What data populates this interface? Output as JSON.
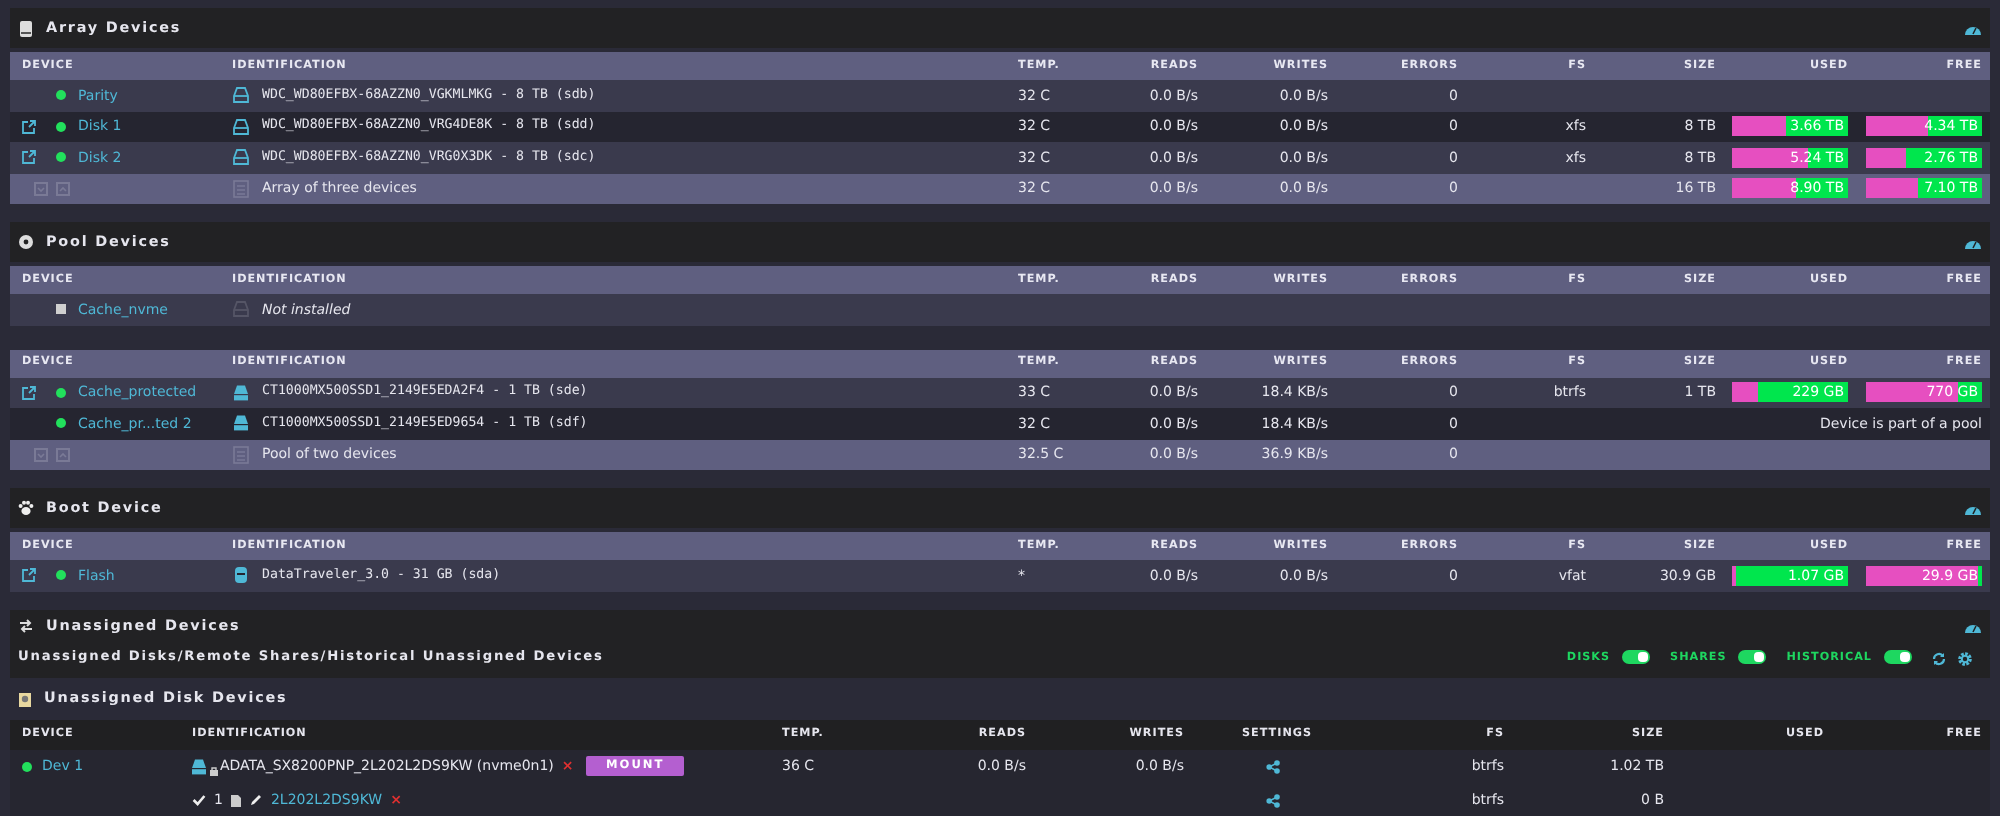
{
  "sections": [
    {
      "title": "Array Devices",
      "tables": [
        {
          "columns": [
            "DEVICE",
            "IDENTIFICATION",
            "TEMP.",
            "READS",
            "WRITES",
            "ERRORS",
            "FS",
            "SIZE",
            "USED",
            "FREE"
          ],
          "rows": [
            {
              "kind": "hdd",
              "link": false,
              "color": "#22e05c",
              "device": "Parity",
              "identification": "WDC_WD80EFBX-68AZZN0_VGKMLMKG - 8 TB (sdb)",
              "temp": "32 C",
              "reads": "0.0 B/s",
              "writes": "0.0 B/s",
              "errors": "0"
            },
            {
              "kind": "hdd",
              "link": true,
              "color": "#22e05c",
              "device": "Disk 1",
              "identification": "WDC_WD80EFBX-68AZZN0_VRG4DE8K - 8 TB (sdd)",
              "temp": "32 C",
              "reads": "0.0 B/s",
              "writes": "0.0 B/s",
              "errors": "0",
              "fs": "xfs",
              "size": "8 TB",
              "used": {
                "text": "3.66 TB",
                "level": 0.46
              },
              "free": {
                "text": "4.34 TB",
                "level": 0.54
              }
            },
            {
              "kind": "hdd",
              "link": true,
              "color": "#22e05c",
              "device": "Disk 2",
              "identification": "WDC_WD80EFBX-68AZZN0_VRG0X3DK - 8 TB (sdc)",
              "temp": "32 C",
              "reads": "0.0 B/s",
              "writes": "0.0 B/s",
              "errors": "0",
              "fs": "xfs",
              "size": "8 TB",
              "used": {
                "text": "5.24 TB",
                "level": 0.65
              },
              "free": {
                "text": "2.76 TB",
                "level": 0.35
              }
            },
            {
              "kind": "summary",
              "identification": "Array of three devices",
              "temp": "32 C",
              "reads": "0.0 B/s",
              "writes": "0.0 B/s",
              "errors": "0",
              "size": "16 TB",
              "used": {
                "text": "8.90 TB",
                "level": 0.56
              },
              "free": {
                "text": "7.10 TB",
                "level": 0.44
              }
            }
          ]
        }
      ]
    },
    {
      "title": "Pool Devices",
      "tables": [
        {
          "columns": [
            "DEVICE",
            "IDENTIFICATION",
            "TEMP.",
            "READS",
            "WRITES",
            "ERRORS",
            "FS",
            "SIZE",
            "USED",
            "FREE"
          ],
          "rows": [
            {
              "kind": "missing",
              "link": false,
              "color": "#cfcfcf",
              "device": "Cache_nvme",
              "identification": "Not installed"
            }
          ]
        },
        {
          "columns": [
            "DEVICE",
            "IDENTIFICATION",
            "TEMP.",
            "READS",
            "WRITES",
            "ERRORS",
            "FS",
            "SIZE",
            "USED",
            "FREE"
          ],
          "rows": [
            {
              "kind": "ssd",
              "link": true,
              "color": "#22e05c",
              "device": "Cache_protected",
              "identification": "CT1000MX500SSD1_2149E5EDA2F4 - 1 TB (sde)",
              "temp": "33 C",
              "reads": "0.0 B/s",
              "writes": "18.4 KB/s",
              "errors": "0",
              "fs": "btrfs",
              "size": "1 TB",
              "used": {
                "text": "229 GB",
                "level": 0.23
              },
              "free": {
                "text": "770 GB",
                "level": 0.79
              }
            },
            {
              "kind": "ssd",
              "link": false,
              "color": "#22e05c",
              "device": "Cache_pr...ted 2",
              "identification": "CT1000MX500SSD1_2149E5ED9654 - 1 TB (sdf)",
              "temp": "32 C",
              "reads": "0.0 B/s",
              "writes": "18.4 KB/s",
              "errors": "0",
              "note": "Device is part of a pool"
            },
            {
              "kind": "summary",
              "identification": "Pool of two devices",
              "temp": "32.5 C",
              "reads": "0.0 B/s",
              "writes": "36.9 KB/s",
              "errors": "0"
            }
          ]
        }
      ]
    },
    {
      "title": "Boot Device",
      "tables": [
        {
          "columns": [
            "DEVICE",
            "IDENTIFICATION",
            "TEMP.",
            "READS",
            "WRITES",
            "ERRORS",
            "FS",
            "SIZE",
            "USED",
            "FREE"
          ],
          "rows": [
            {
              "kind": "usb",
              "link": true,
              "color": "#22e05c",
              "device": "Flash",
              "identification": "DataTraveler_3.0 - 31 GB (sda)",
              "temp": "*",
              "reads": "0.0 B/s",
              "writes": "0.0 B/s",
              "errors": "0",
              "fs": "vfat",
              "size": "30.9 GB",
              "used": {
                "text": "1.07 GB",
                "level": 0.035
              },
              "free": {
                "text": "29.9 GB",
                "level": 0.97
              }
            }
          ]
        }
      ]
    }
  ],
  "unassigned": {
    "title": "Unassigned Devices",
    "subtitle": "Unassigned Disks/Remote Shares/Historical Unassigned Devices",
    "toggles": [
      {
        "label": "DISKS",
        "on": true
      },
      {
        "label": "SHARES",
        "on": true
      },
      {
        "label": "HISTORICAL",
        "on": true
      }
    ],
    "disks": {
      "title": "Unassigned Disk Devices",
      "columns": [
        "DEVICE",
        "IDENTIFICATION",
        "TEMP.",
        "READS",
        "WRITES",
        "SETTINGS",
        "FS",
        "SIZE",
        "USED",
        "FREE"
      ],
      "devices": [
        {
          "color": "#22e05c",
          "device": "Dev 1",
          "identification": "ADATA_SX8200PNP_2L202L2DS9KW (nvme0n1)",
          "remove": "×",
          "button": "MOUNT",
          "temp": "36 C",
          "reads": "0.0 B/s",
          "writes": "0.0 B/s",
          "fs": "btrfs",
          "size": "1.02 TB",
          "partitions": [
            {
              "checked": true,
              "number": "1",
              "label": "2L202L2DS9KW",
              "remove": "×",
              "fs": "btrfs",
              "size": "0 B"
            }
          ]
        }
      ]
    }
  }
}
